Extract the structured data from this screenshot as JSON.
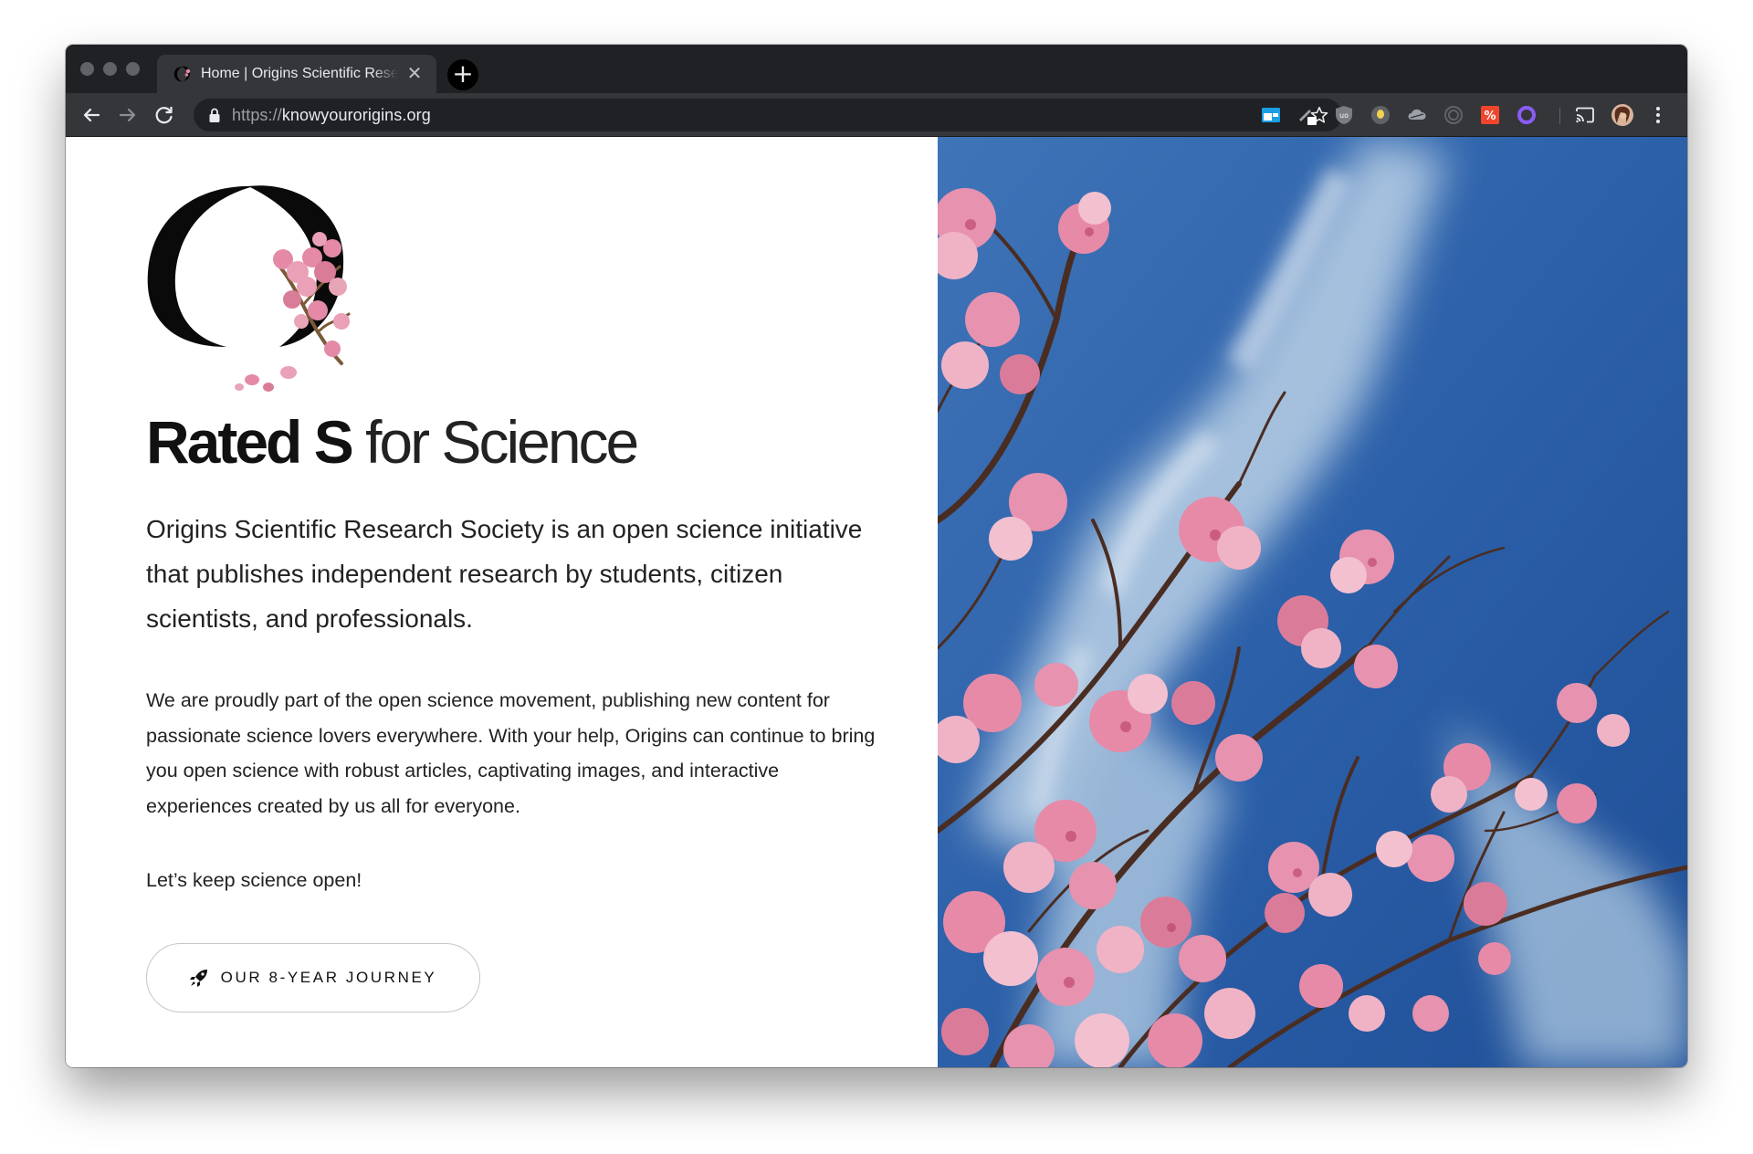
{
  "browser": {
    "tab": {
      "title": "Home | Origins Scientific Research Society",
      "close_glyph": "✕"
    },
    "new_tab_glyph": "+",
    "url": {
      "scheme": "https://",
      "host": "knowyourorigins.org"
    },
    "toolbar_icons": [
      "back-arrow-icon",
      "forward-arrow-icon",
      "reload-icon",
      "lock-icon",
      "star-icon",
      "cast-icon",
      "profile-avatar",
      "more-vert-icon"
    ],
    "extension_icons": [
      "window-extension-icon",
      "pen-extension-icon",
      "ublock-shield-icon",
      "bulb-extension-icon",
      "cloud-extension-icon",
      "spiral-extension-icon",
      "percent-extension-icon",
      "purple-ring-extension-icon"
    ],
    "colors": {
      "frame": "#202124",
      "toolbar": "#35363a",
      "omnibox": "#202124"
    }
  },
  "hero": {
    "headline_bold": "Rated S",
    "headline_light": " for Science",
    "lead": "Origins Scientific Research Society is an open science initiative that publishes independent research by students, citizen scientists, and professionals.",
    "body": "We are proudly part of the open science movement, publishing new content for passionate science lovers everywhere. With your help, Origins can continue to bring you open science with robust articles, captivating images, and interactive experiences created by us all for everyone.",
    "keep_open": "Let’s keep science open!",
    "cta_label": "OUR 8-YEAR JOURNEY",
    "cta_icon": "rocket-icon",
    "image_icon": "cherry-blossom-photo",
    "colors": {
      "sky": "#2b5ea8",
      "blossom": "#e48aa6"
    }
  }
}
